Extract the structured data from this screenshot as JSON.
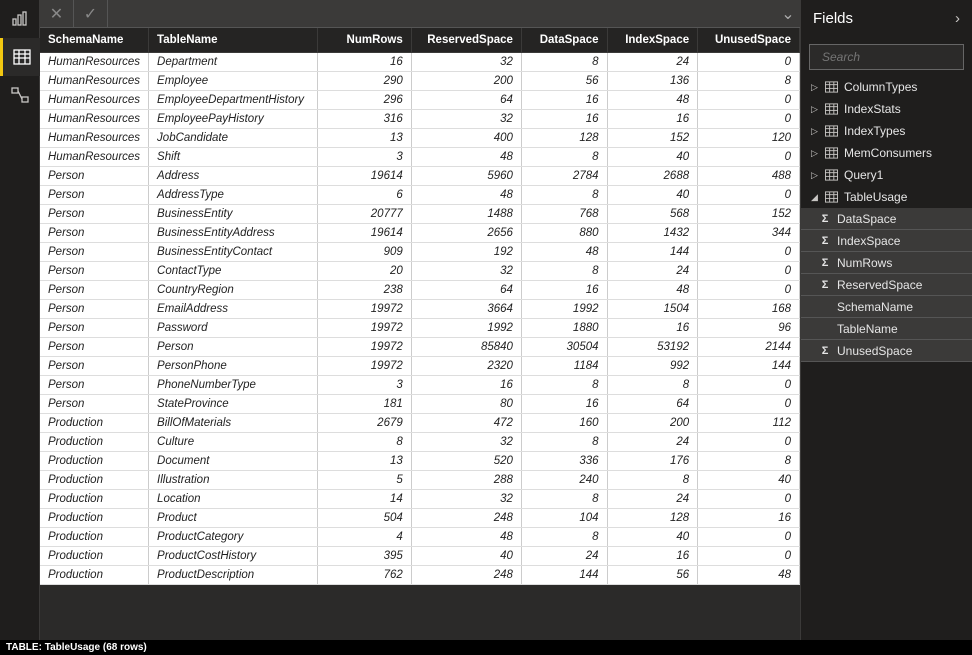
{
  "nav": {
    "items": [
      {
        "name": "report-view-icon"
      },
      {
        "name": "data-view-icon"
      },
      {
        "name": "model-view-icon"
      }
    ],
    "active_index": 1
  },
  "formula_bar": {
    "cancel_label": "✕",
    "commit_label": "✓",
    "value": "",
    "dropdown_glyph": "⌄"
  },
  "table": {
    "columns": [
      {
        "label": "SchemaName",
        "numeric": false
      },
      {
        "label": "TableName",
        "numeric": false
      },
      {
        "label": "NumRows",
        "numeric": true
      },
      {
        "label": "ReservedSpace",
        "numeric": true
      },
      {
        "label": "DataSpace",
        "numeric": true
      },
      {
        "label": "IndexSpace",
        "numeric": true
      },
      {
        "label": "UnusedSpace",
        "numeric": true
      }
    ],
    "rows": [
      [
        "HumanResources",
        "Department",
        "16",
        "32",
        "8",
        "24",
        "0"
      ],
      [
        "HumanResources",
        "Employee",
        "290",
        "200",
        "56",
        "136",
        "8"
      ],
      [
        "HumanResources",
        "EmployeeDepartmentHistory",
        "296",
        "64",
        "16",
        "48",
        "0"
      ],
      [
        "HumanResources",
        "EmployeePayHistory",
        "316",
        "32",
        "16",
        "16",
        "0"
      ],
      [
        "HumanResources",
        "JobCandidate",
        "13",
        "400",
        "128",
        "152",
        "120"
      ],
      [
        "HumanResources",
        "Shift",
        "3",
        "48",
        "8",
        "40",
        "0"
      ],
      [
        "Person",
        "Address",
        "19614",
        "5960",
        "2784",
        "2688",
        "488"
      ],
      [
        "Person",
        "AddressType",
        "6",
        "48",
        "8",
        "40",
        "0"
      ],
      [
        "Person",
        "BusinessEntity",
        "20777",
        "1488",
        "768",
        "568",
        "152"
      ],
      [
        "Person",
        "BusinessEntityAddress",
        "19614",
        "2656",
        "880",
        "1432",
        "344"
      ],
      [
        "Person",
        "BusinessEntityContact",
        "909",
        "192",
        "48",
        "144",
        "0"
      ],
      [
        "Person",
        "ContactType",
        "20",
        "32",
        "8",
        "24",
        "0"
      ],
      [
        "Person",
        "CountryRegion",
        "238",
        "64",
        "16",
        "48",
        "0"
      ],
      [
        "Person",
        "EmailAddress",
        "19972",
        "3664",
        "1992",
        "1504",
        "168"
      ],
      [
        "Person",
        "Password",
        "19972",
        "1992",
        "1880",
        "16",
        "96"
      ],
      [
        "Person",
        "Person",
        "19972",
        "85840",
        "30504",
        "53192",
        "2144"
      ],
      [
        "Person",
        "PersonPhone",
        "19972",
        "2320",
        "1184",
        "992",
        "144"
      ],
      [
        "Person",
        "PhoneNumberType",
        "3",
        "16",
        "8",
        "8",
        "0"
      ],
      [
        "Person",
        "StateProvince",
        "181",
        "80",
        "16",
        "64",
        "0"
      ],
      [
        "Production",
        "BillOfMaterials",
        "2679",
        "472",
        "160",
        "200",
        "112"
      ],
      [
        "Production",
        "Culture",
        "8",
        "32",
        "8",
        "24",
        "0"
      ],
      [
        "Production",
        "Document",
        "13",
        "520",
        "336",
        "176",
        "8"
      ],
      [
        "Production",
        "Illustration",
        "5",
        "288",
        "240",
        "8",
        "40"
      ],
      [
        "Production",
        "Location",
        "14",
        "32",
        "8",
        "24",
        "0"
      ],
      [
        "Production",
        "Product",
        "504",
        "248",
        "104",
        "128",
        "16"
      ],
      [
        "Production",
        "ProductCategory",
        "4",
        "48",
        "8",
        "40",
        "0"
      ],
      [
        "Production",
        "ProductCostHistory",
        "395",
        "40",
        "24",
        "16",
        "0"
      ],
      [
        "Production",
        "ProductDescription",
        "762",
        "248",
        "144",
        "56",
        "48"
      ]
    ]
  },
  "status": {
    "text": "TABLE: TableUsage (68 rows)"
  },
  "fields": {
    "title": "Fields",
    "search_placeholder": "Search",
    "tables": [
      {
        "name": "ColumnTypes",
        "expanded": false
      },
      {
        "name": "IndexStats",
        "expanded": false
      },
      {
        "name": "IndexTypes",
        "expanded": false
      },
      {
        "name": "MemConsumers",
        "expanded": false
      },
      {
        "name": "Query1",
        "expanded": false
      },
      {
        "name": "TableUsage",
        "expanded": true,
        "columns": [
          {
            "name": "DataSpace",
            "numeric": true
          },
          {
            "name": "IndexSpace",
            "numeric": true
          },
          {
            "name": "NumRows",
            "numeric": true
          },
          {
            "name": "ReservedSpace",
            "numeric": true
          },
          {
            "name": "SchemaName",
            "numeric": false
          },
          {
            "name": "TableName",
            "numeric": false
          },
          {
            "name": "UnusedSpace",
            "numeric": true
          }
        ]
      }
    ]
  }
}
